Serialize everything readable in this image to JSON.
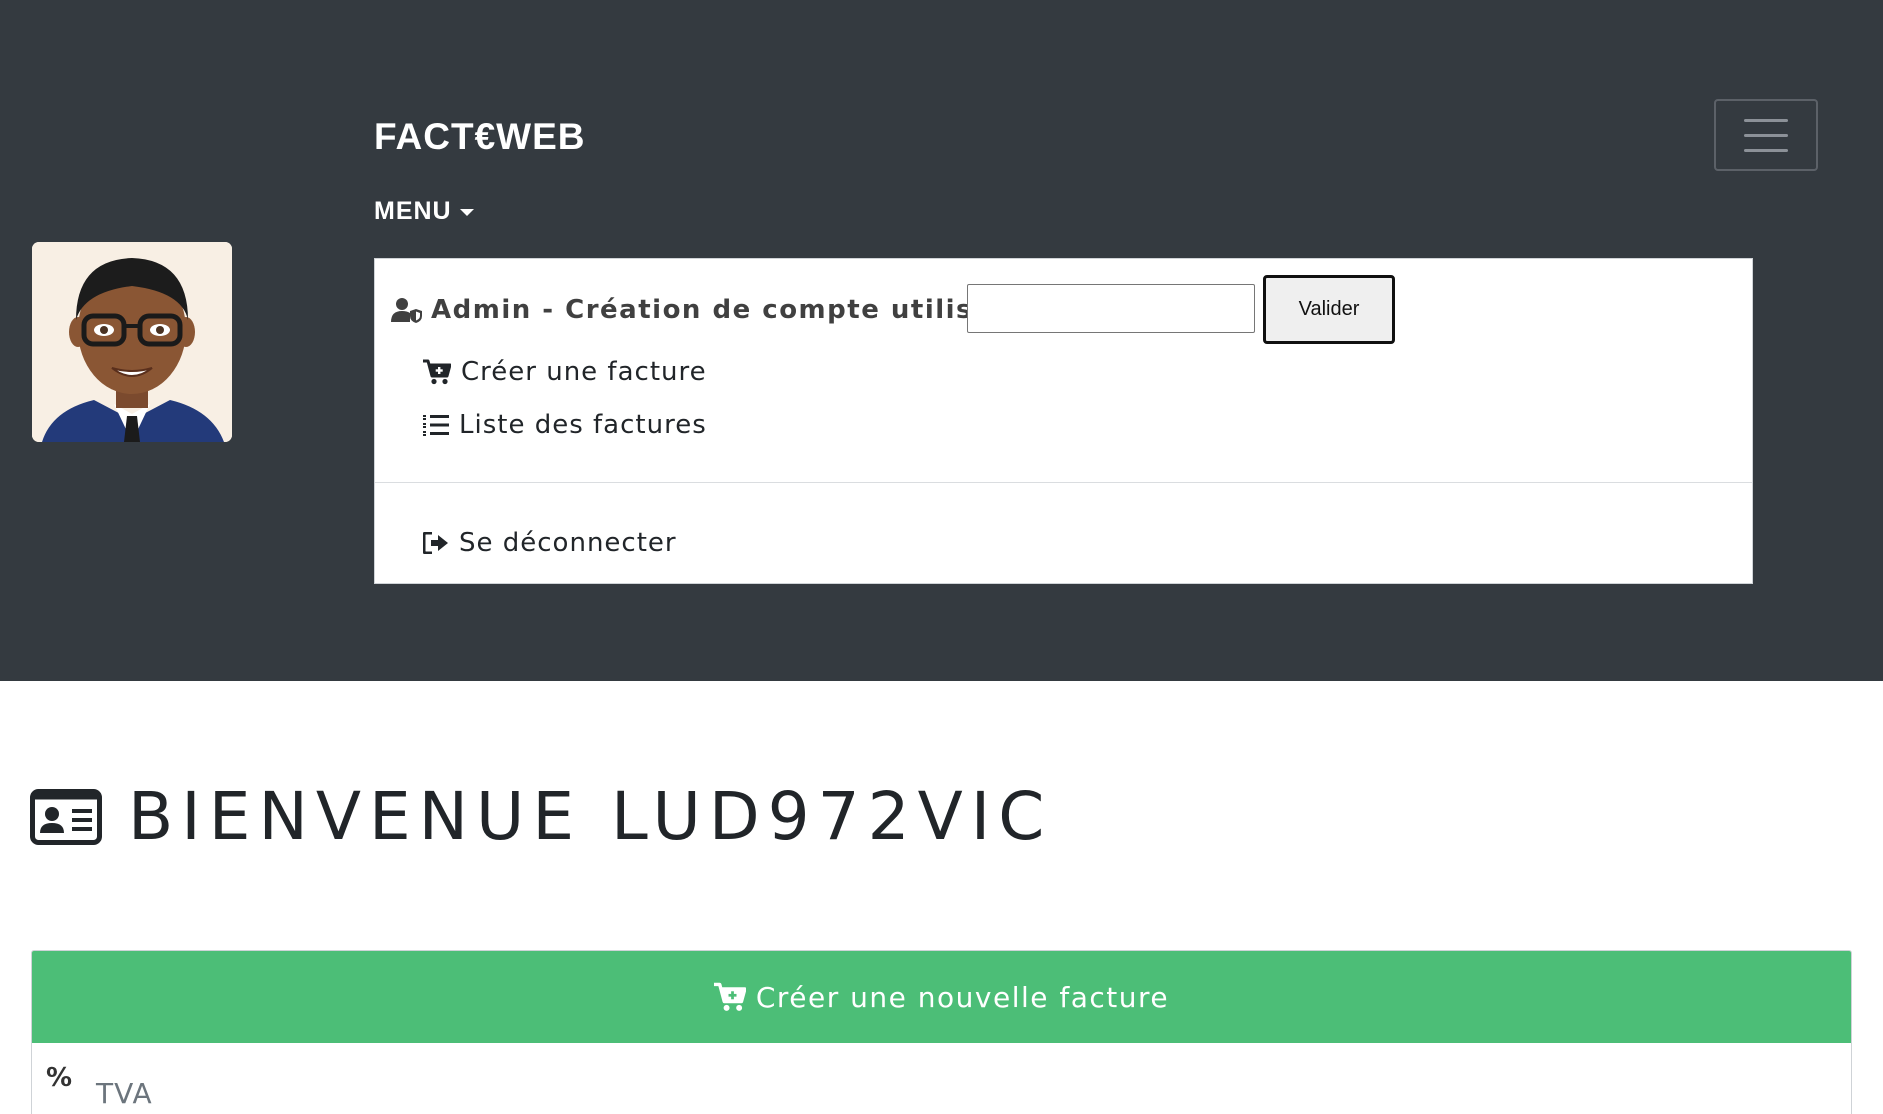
{
  "header": {
    "brand": "FACT€WEB",
    "menu_label": "MENU",
    "avatar_icon": "avatar-illustration",
    "hamburger_icon": "hamburger-menu-icon"
  },
  "dropdown": {
    "admin_label": "Admin - Création de compte utilisateur",
    "admin_input_value": "",
    "admin_button": "Valider",
    "items": [
      {
        "label": "Créer une facture",
        "icon": "cart-plus-icon"
      },
      {
        "label": "Liste des factures",
        "icon": "list-ol-icon"
      }
    ],
    "logout_label": "Se déconnecter"
  },
  "main": {
    "welcome_title": "BIENVENUE LUD972VIC",
    "new_invoice_button": "Créer une nouvelle facture",
    "tva_icon_glyph": "%",
    "tva_label": "TVA"
  },
  "colors": {
    "header_bg": "#343a40",
    "accent_green": "#4cbe77",
    "panel_bg": "#ffffff"
  }
}
